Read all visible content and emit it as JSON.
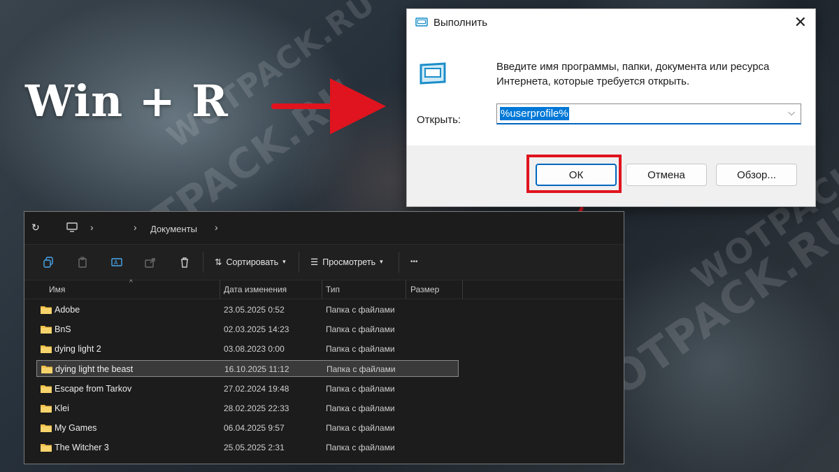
{
  "overlay": {
    "hotkey_label": "Win + R",
    "watermark_text": "WOTPACK.RU"
  },
  "run_dialog": {
    "title": "Выполнить",
    "close_glyph": "✕",
    "description": "Введите имя программы, папки, документа или ресурса Интернета, которые требуется открыть.",
    "open_label": "Открыть:",
    "open_value": "%userprofile%",
    "buttons": {
      "ok": "ОК",
      "cancel": "Отмена",
      "browse": "Обзор..."
    },
    "icon": "run-app-icon"
  },
  "explorer": {
    "breadcrumb": "Документы",
    "toolbar": {
      "sort_label": "Сортировать",
      "view_label": "Просмотреть",
      "more_glyph": "•••"
    },
    "columns": [
      "Имя",
      "Дата изменения",
      "Тип",
      "Размер"
    ],
    "rows": [
      {
        "name": "Adobe",
        "date": "23.05.2025 0:52",
        "type": "Папка с файлами"
      },
      {
        "name": "BnS",
        "date": "02.03.2025 14:23",
        "type": "Папка с файлами"
      },
      {
        "name": "dying light 2",
        "date": "03.08.2023 0:00",
        "type": "Папка с файлами"
      },
      {
        "name": "dying light the beast",
        "date": "16.10.2025 11:12",
        "type": "Папка с файлами",
        "selected": true
      },
      {
        "name": "Escape from Tarkov",
        "date": "27.02.2024 19:48",
        "type": "Папка с файлами"
      },
      {
        "name": "Klei",
        "date": "28.02.2025 22:33",
        "type": "Папка с файлами"
      },
      {
        "name": "My Games",
        "date": "06.04.2025 9:57",
        "type": "Папка с файлами"
      },
      {
        "name": "The Witcher 3",
        "date": "25.05.2025 2:31",
        "type": "Папка с файлами"
      }
    ]
  },
  "colors": {
    "arrow": "#e0141e",
    "highlight": "#e0141e",
    "selection": "#0078d7",
    "folder": "#f2c14b"
  }
}
